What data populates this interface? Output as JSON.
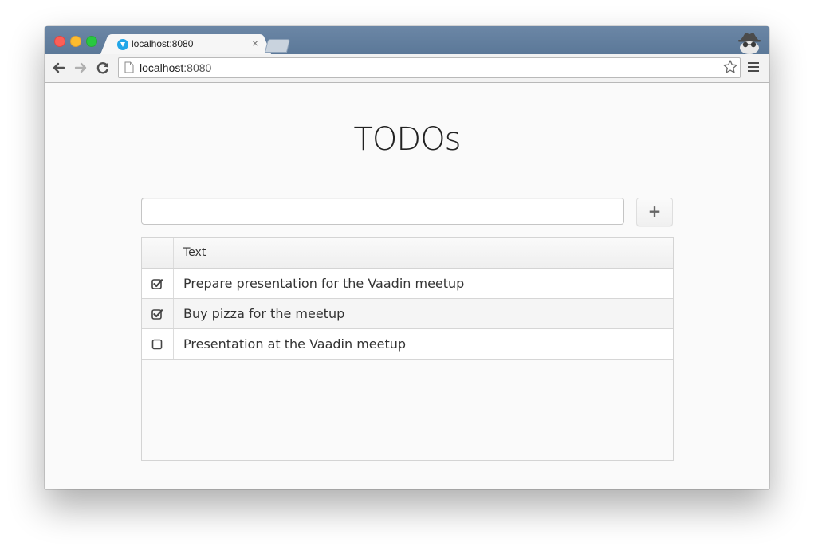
{
  "browser": {
    "tab_title": "localhost:8080",
    "tab_close": "×",
    "url_host": "localhost",
    "url_port": ":8080"
  },
  "page": {
    "title": "TODOs",
    "input": {
      "value": "",
      "placeholder": ""
    },
    "add_button_label": "+",
    "grid": {
      "header": "Text",
      "rows": [
        {
          "text": "Prepare presentation for the Vaadin meetup",
          "done": true
        },
        {
          "text": "Buy pizza for the meetup",
          "done": true
        },
        {
          "text": "Presentation at the Vaadin meetup",
          "done": false
        }
      ]
    }
  },
  "colors": {
    "tabstrip": "#5b7898",
    "favicon": "#21a6e8"
  }
}
